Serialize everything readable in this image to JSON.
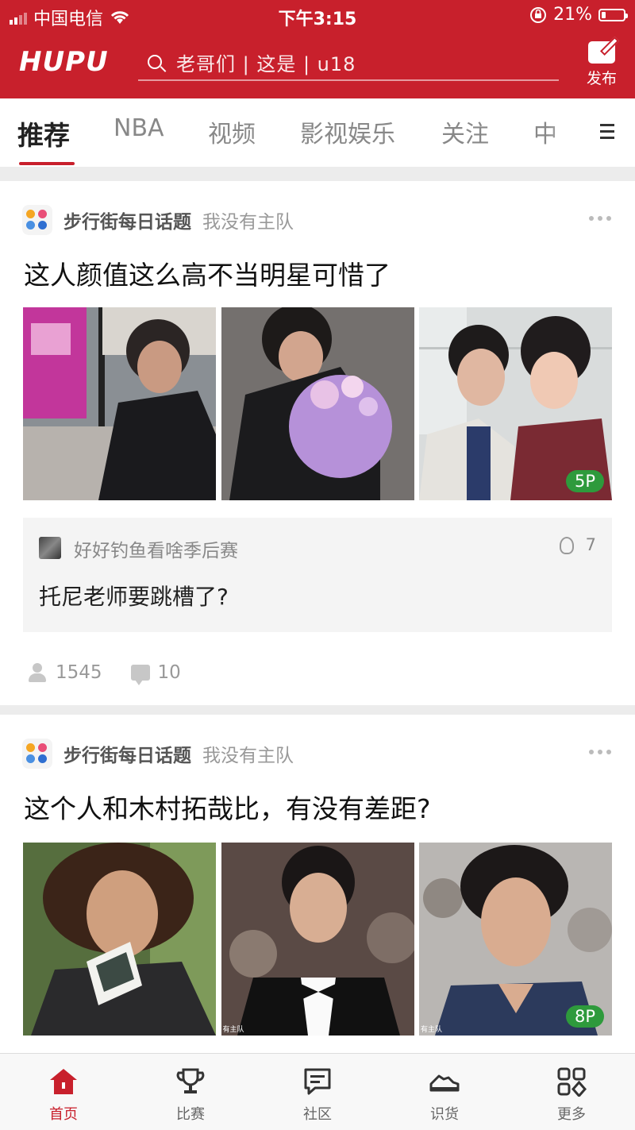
{
  "status_bar": {
    "carrier": "中国电信",
    "time": "下午3:15",
    "battery_percent": "21%",
    "battery_level": 0.21
  },
  "header": {
    "logo": "HUPU",
    "search_placeholder": "老哥们 | 这是 | u18",
    "publish_label": "发布"
  },
  "tabs": [
    {
      "label": "推荐",
      "active": true
    },
    {
      "label": "NBA"
    },
    {
      "label": "视频"
    },
    {
      "label": "影视娱乐"
    },
    {
      "label": "关注"
    },
    {
      "label": "中"
    }
  ],
  "posts": [
    {
      "forum": "步行街每日话题",
      "team": "我没有主队",
      "title": "这人颜值这么高不当明星可惜了",
      "photo_count_badge": "5P",
      "reply": {
        "user": "好好钓鱼看啥季后赛",
        "likes": "7",
        "text": "托尼老师要跳槽了?"
      },
      "views": "1545",
      "comments": "10"
    },
    {
      "forum": "步行街每日话题",
      "team": "我没有主队",
      "title": "这个人和木村拓哉比，有没有差距?",
      "photo_count_badge": "8P",
      "watermark": "有主队"
    }
  ],
  "bottom_nav": [
    {
      "label": "首页",
      "icon": "home-icon",
      "active": true
    },
    {
      "label": "比赛",
      "icon": "trophy-icon"
    },
    {
      "label": "社区",
      "icon": "community-icon"
    },
    {
      "label": "识货",
      "icon": "sneaker-icon"
    },
    {
      "label": "更多",
      "icon": "grid-more-icon"
    }
  ],
  "colors": {
    "brand_red": "#c8202c",
    "badge_green": "#2e9a3c"
  }
}
